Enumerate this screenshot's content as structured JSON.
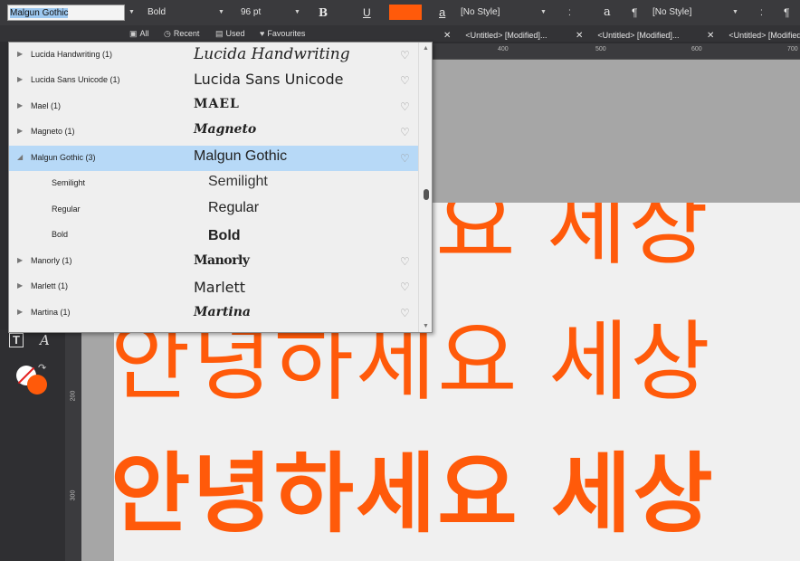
{
  "toolbar": {
    "font_family_value": "Malgun Gothic",
    "font_style_value": "Bold",
    "font_size_value": "96 pt",
    "bold_label": "B",
    "underline_label": "U",
    "text_color": "#ff5a0a",
    "char_style_icon": "a",
    "char_style_value": "[No Style]",
    "para_style_icon": "¶",
    "para_style_value": "[No Style]",
    "style_a_icon": "a",
    "pilcrow_icon": "¶"
  },
  "filters": {
    "all": "All",
    "recent": "Recent",
    "used": "Used",
    "favourites": "Favourites"
  },
  "tabs": [
    {
      "label": "<Untitled> [Modified]..."
    },
    {
      "label": "<Untitled> [Modified]..."
    },
    {
      "label": "<Untitled> [Modified]..."
    }
  ],
  "ruler": {
    "top_ticks": [
      "400",
      "500",
      "600",
      "700"
    ],
    "left_ticks": [
      "200",
      "300"
    ]
  },
  "font_list": [
    {
      "name": "Lucida Handwriting (1)",
      "preview": "Lucida Handwriting"
    },
    {
      "name": "Lucida Sans Unicode (1)",
      "preview": "Lucida Sans Unicode"
    },
    {
      "name": "Mael (1)",
      "preview": "MAEL"
    },
    {
      "name": "Magneto (1)",
      "preview": "Magneto"
    },
    {
      "name": "Malgun Gothic (3)",
      "preview": "Malgun Gothic"
    },
    {
      "name": "Semilight",
      "preview": "Semilight"
    },
    {
      "name": "Regular",
      "preview": "Regular"
    },
    {
      "name": "Bold",
      "preview": "Bold"
    },
    {
      "name": "Manorly (1)",
      "preview": "Manorly"
    },
    {
      "name": "Marlett (1)",
      "preview": "Marlett"
    },
    {
      "name": "Martina (1)",
      "preview": "Martina"
    }
  ],
  "canvas": {
    "row1": "안녕하세요 세상",
    "row2": "안녕하세요 세상",
    "row3": "안녕하세요 세상",
    "text_color": "#ff5a0a"
  },
  "icons": {
    "expand": "▶",
    "collapse": "◢",
    "heart": "♡",
    "close": "✕",
    "dropdown": "▼"
  }
}
